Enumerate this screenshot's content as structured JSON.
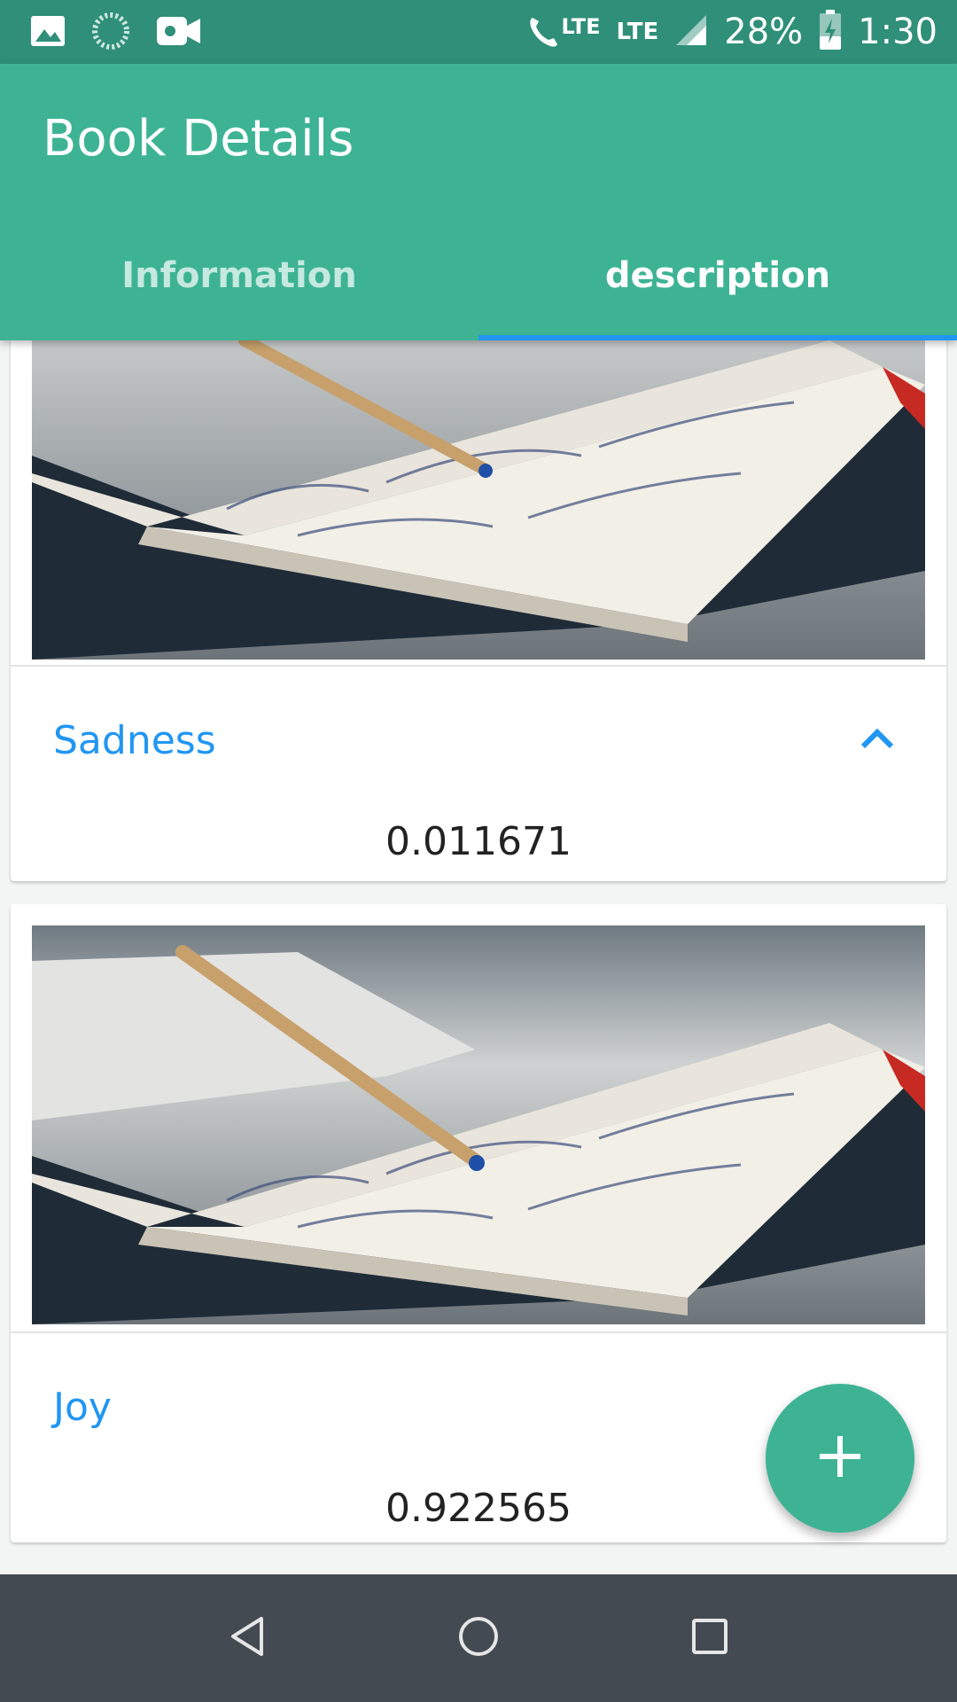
{
  "status_bar": {
    "lte1": "LTE",
    "lte2": "LTE",
    "battery": "28%",
    "time": "1:30"
  },
  "app_bar": {
    "title": "Book Details",
    "tabs": [
      {
        "label": "Information",
        "active": false
      },
      {
        "label": "description",
        "active": true
      }
    ]
  },
  "cards": [
    {
      "label": "Sadness",
      "value": "0.011671",
      "expanded": true
    },
    {
      "label": "Joy",
      "value": "0.922565"
    }
  ],
  "colors": {
    "primary": "#3db394",
    "status_bar": "#2f8f78",
    "accent": "#2196f3",
    "nav_bar": "#444a51"
  },
  "icons": {
    "fab": "plus-icon",
    "card_toggle": "chevron-up-icon",
    "nav": [
      "back-icon",
      "home-icon",
      "recents-icon"
    ]
  }
}
